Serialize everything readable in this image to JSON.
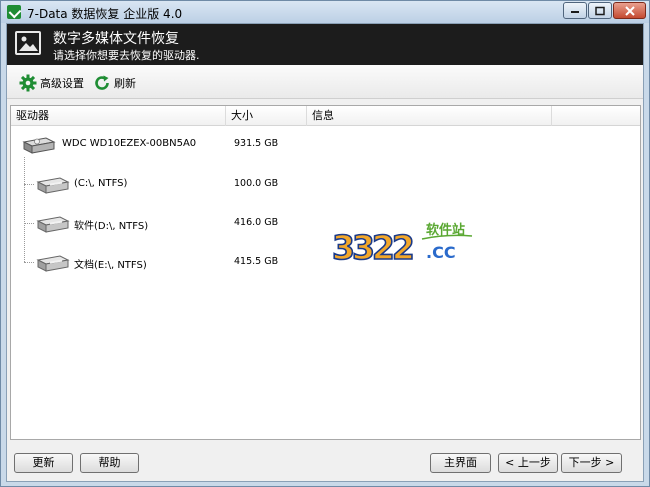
{
  "window": {
    "title": "7-Data 数据恢复 企业版 4.0"
  },
  "header": {
    "title": "数字多媒体文件恢复",
    "subtitle": "请选择你想要去恢复的驱动器."
  },
  "toolbar": {
    "settings_label": "高级设置",
    "refresh_label": "刷新"
  },
  "table": {
    "columns": [
      "驱动器",
      "大小",
      "信息"
    ],
    "rows": [
      {
        "name": "WDC  WD10EZEX-00BN5A0",
        "size": "931.5 GB",
        "info": ""
      },
      {
        "name": "(C:\\, NTFS)",
        "size": "100.0 GB",
        "info": ""
      },
      {
        "name": "软件(D:\\, NTFS)",
        "size": "416.0 GB",
        "info": ""
      },
      {
        "name": "文档(E:\\, NTFS)",
        "size": "415.5 GB",
        "info": ""
      }
    ]
  },
  "watermark": {
    "number": "3322",
    "suffix": ".CC",
    "tag": "软件站"
  },
  "buttons": {
    "update": "更新",
    "help": "帮助",
    "main": "主界面",
    "prev": "< 上一步",
    "next": "下一步 >"
  },
  "colors": {
    "accent_green": "#1f8d34",
    "header_bg": "#1c1c1c"
  }
}
